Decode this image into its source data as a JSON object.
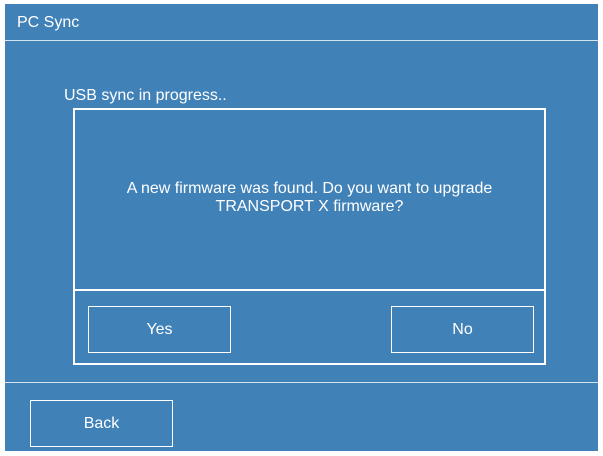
{
  "header": {
    "title": "PC Sync"
  },
  "status": {
    "text": "USB sync in progress.."
  },
  "dialog": {
    "message_line1": "A new firmware was found. Do you want to upgrade",
    "message_line2": "TRANSPORT X firmware?",
    "yes_label": "Yes",
    "no_label": "No"
  },
  "footer": {
    "back_label": "Back"
  },
  "colors": {
    "background": "#4081b8",
    "foreground": "#ffffff"
  }
}
